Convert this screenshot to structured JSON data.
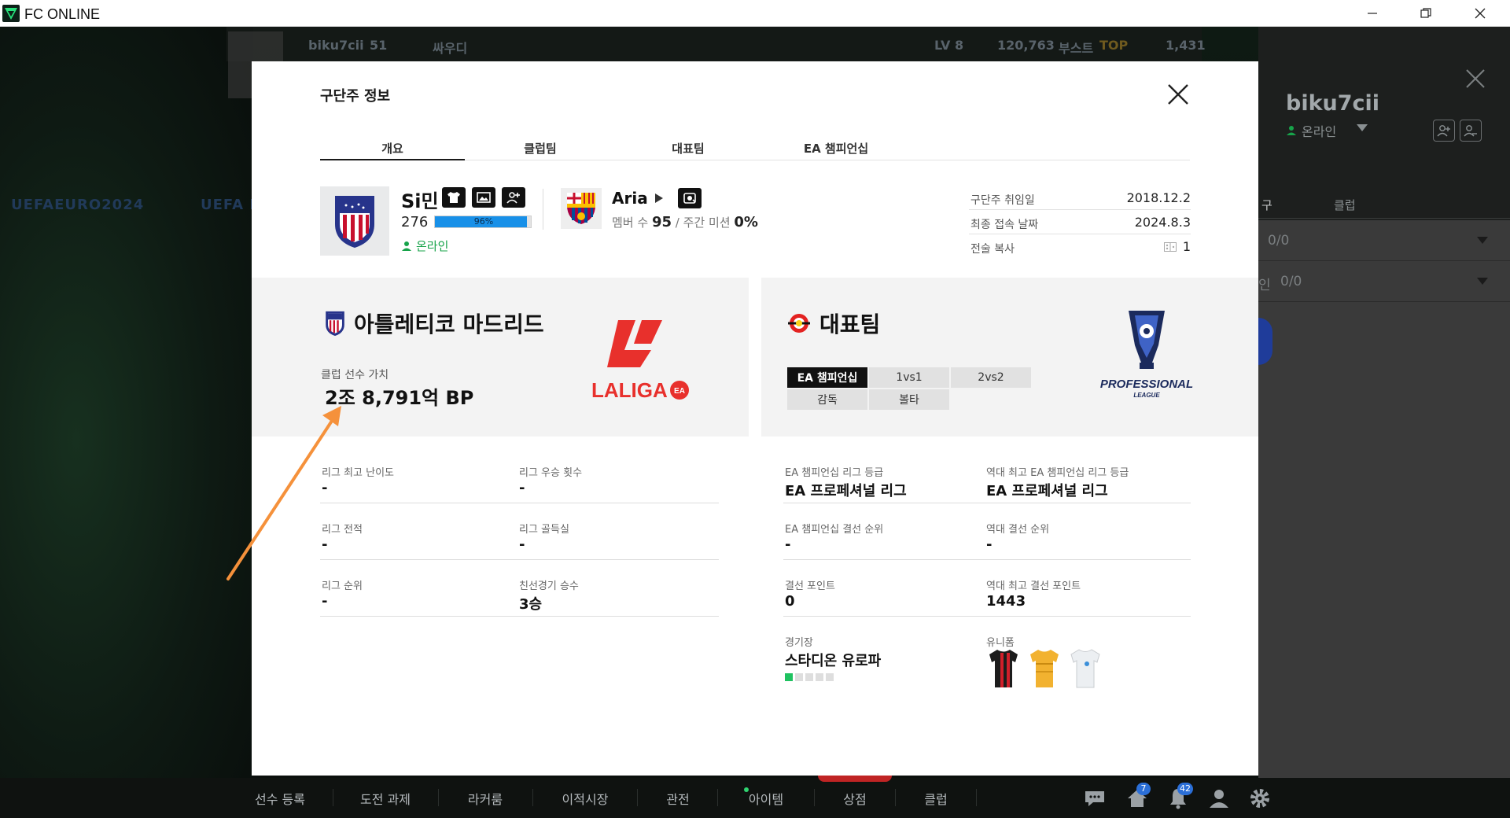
{
  "window": {
    "title": "FC ONLINE"
  },
  "background": {
    "euro_text": "UEFAEURO2024",
    "euro_text2": "UEFA E",
    "player_name": "biku7cii",
    "player_level_short": "51",
    "team_nick": "싸우디",
    "lv": "LV 8",
    "bp": "120,763",
    "boost": "부스트",
    "top": "TOP",
    "right_value": "1,431"
  },
  "right_panel": {
    "name": "biku7cii",
    "status": "온라인",
    "tab_left": "구",
    "tab_club": "클럽",
    "row1": "0/0",
    "row2_prefix": "인",
    "row2": "0/0"
  },
  "modal": {
    "title": "구단주 정보",
    "tabs": [
      {
        "label": "개요"
      },
      {
        "label": "클럽팀"
      },
      {
        "label": "대표팀"
      },
      {
        "label": "EA 챔피언십"
      }
    ],
    "manager": {
      "name": "Si민",
      "level": "276",
      "xp_percent_label": "96%",
      "xp_percent": 96,
      "status": "온라인"
    },
    "club": {
      "name": "Aria",
      "members_label": "멤버 수",
      "members": "95",
      "mission_label": "/ 주간 미션",
      "mission": "0%"
    },
    "info": [
      {
        "label": "구단주 취임일",
        "value": "2018.12.2"
      },
      {
        "label": "최종 접속 날짜",
        "value": "2024.8.3"
      },
      {
        "label": "전술 복사",
        "value": "1"
      }
    ],
    "club_card": {
      "title": "아틀레티코 마드리드",
      "league_logo_text": "LALIGA",
      "value_label": "클럽 선수 가치",
      "value": "2조 8,791억 BP"
    },
    "national_card": {
      "title": "대표팀",
      "segments": [
        "EA 챔피언십",
        "1vs1",
        "2vs2",
        "감독",
        "볼타"
      ],
      "league_logo_text": "PROFESSIONAL",
      "league_logo_sub": "LEAGUE"
    },
    "club_stats": [
      {
        "label": "리그 최고 난이도",
        "value": "-"
      },
      {
        "label": "리그 우승 횟수",
        "value": "-"
      },
      {
        "label": "리그 전적",
        "value": "-"
      },
      {
        "label": "리그 골득실",
        "value": "-"
      },
      {
        "label": "리그 순위",
        "value": "-"
      },
      {
        "label": "친선경기 승수",
        "value": "3승"
      }
    ],
    "national_stats": [
      {
        "label": "EA 챔피언십 리그 등급",
        "value": "EA 프로페셔널 리그"
      },
      {
        "label": "역대 최고 EA 챔피언십 리그 등급",
        "value": "EA 프로페셔널 리그"
      },
      {
        "label": "EA 챔피언십 결선 순위",
        "value": "-"
      },
      {
        "label": "역대 결선 순위",
        "value": "-"
      },
      {
        "label": "결선 포인트",
        "value": "0"
      },
      {
        "label": "역대 최고 결선 포인트",
        "value": "1443"
      },
      {
        "label": "경기장",
        "value": "스타디온 유로파"
      },
      {
        "label": "유니폼",
        "value": ""
      }
    ]
  },
  "bottom_bar": {
    "items": [
      {
        "label": "선수 등록"
      },
      {
        "label": "도전 과제"
      },
      {
        "label": "라커룸"
      },
      {
        "label": "이적시장"
      },
      {
        "label": "관전"
      },
      {
        "label": "아이템"
      },
      {
        "label": "상점"
      },
      {
        "label": "클럽"
      }
    ],
    "badges": {
      "home": "7",
      "bell": "42"
    }
  },
  "colors": {
    "accent_blue": "#1890e8",
    "online_green": "#17a34a",
    "laliga_red": "#e8302c",
    "arrow_orange": "#f5913b"
  }
}
